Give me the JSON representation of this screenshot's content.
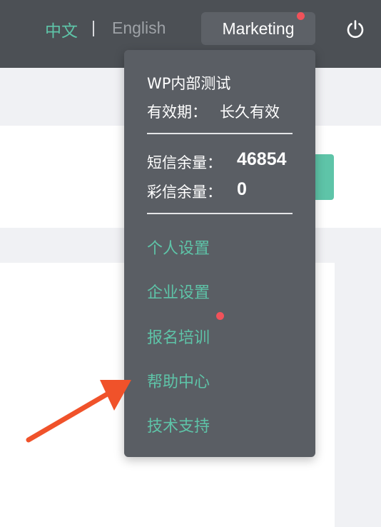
{
  "header": {
    "lang_zh": "中文",
    "lang_en": "English",
    "account_label": "Marketing",
    "power_icon": "power-icon"
  },
  "dropdown": {
    "org_name": "WP内部测试",
    "validity_label": "有效期：",
    "validity_value": "长久有效",
    "sms_label": "短信余量：",
    "sms_value": "46854",
    "mms_label": "彩信余量：",
    "mms_value": "0",
    "menu": [
      {
        "label": "个人设置"
      },
      {
        "label": "企业设置"
      },
      {
        "label": "报名培训"
      },
      {
        "label": "帮助中心"
      },
      {
        "label": "技术支持"
      }
    ]
  },
  "colors": {
    "accent": "#5ec4a8",
    "header_bg": "#4c5055",
    "dropdown_bg": "#5a5e64",
    "notification": "#f0525a",
    "arrow": "#f0522a"
  }
}
